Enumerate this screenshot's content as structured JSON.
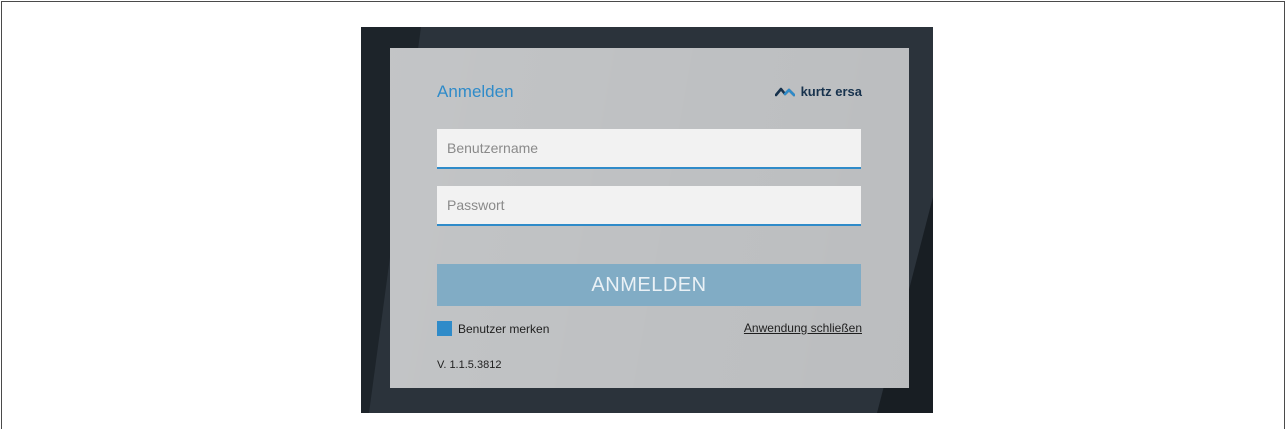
{
  "login": {
    "title": "Anmelden",
    "username_placeholder": "Benutzername",
    "username_value": "",
    "password_placeholder": "Passwort",
    "password_value": "",
    "login_button_label": "ANMELDEN",
    "remember_label": "Benutzer merken",
    "remember_checked": true,
    "close_app_label": "Anwendung schließen",
    "version": "V. 1.1.5.3812"
  },
  "brand": {
    "name": "kurtz ersa",
    "logo_icon": "kurtz-ersa-wave-icon"
  },
  "colors": {
    "accent": "#2f8bc9",
    "button": "#81acc5",
    "panel": "#bfc1c3",
    "device_frame": "#2b333b",
    "brand_text": "#17324d"
  }
}
